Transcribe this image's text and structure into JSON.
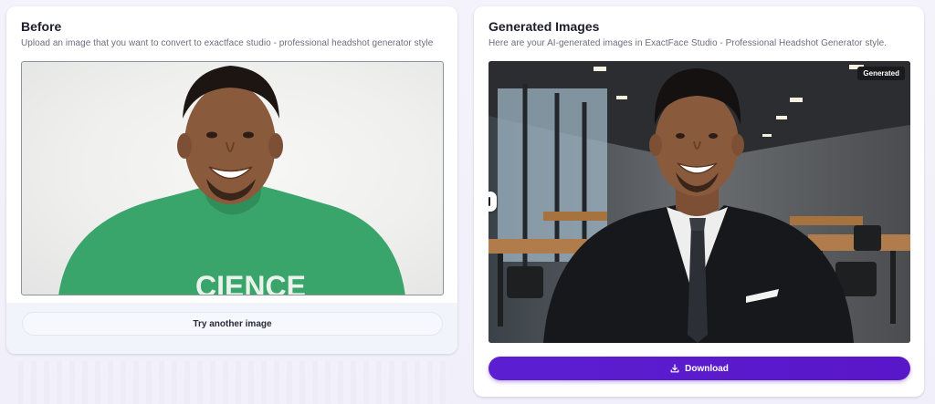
{
  "before": {
    "title": "Before",
    "subtitle": "Upload an image that you want to convert to exactface studio - professional headshot generator style",
    "shirt_text": "CIENCE",
    "try_another_label": "Try another image"
  },
  "after": {
    "title": "Generated Images",
    "subtitle": "Here are your AI-generated images in ExactFace Studio - Professional Headshot Generator style.",
    "badge_label": "Generated",
    "download_label": "Download",
    "download_icon": "download-icon"
  },
  "colors": {
    "accent": "#5b1fd1",
    "shirt_green": "#3aa56b",
    "badge_bg": "#1a1a1c"
  }
}
